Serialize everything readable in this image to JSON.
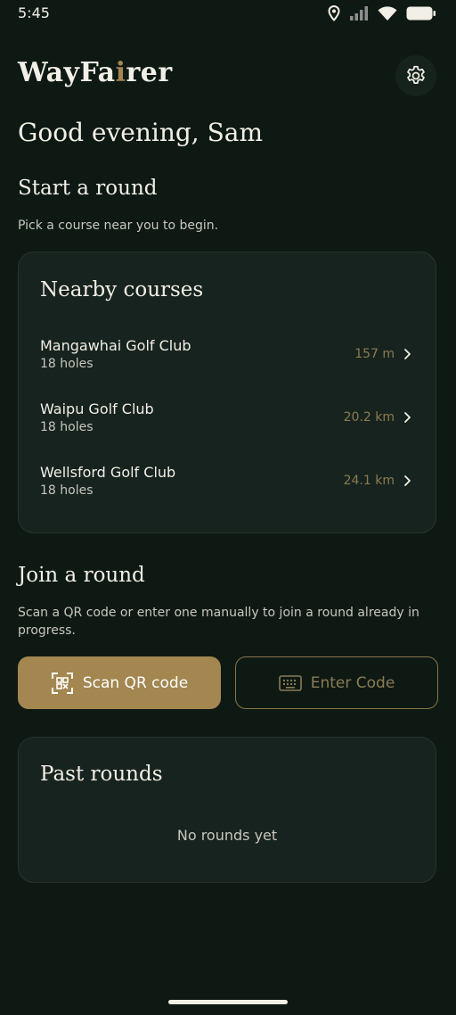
{
  "status_bar": {
    "time": "5:45",
    "icons": [
      "location-icon",
      "signal-icon",
      "wifi-icon",
      "battery-icon"
    ]
  },
  "header": {
    "logo_part1": "WayFa",
    "logo_part2": "i",
    "logo_part3": "rer",
    "settings_icon": "gear-icon"
  },
  "greeting": "Good evening, Sam",
  "start_round": {
    "title": "Start a round",
    "description": "Pick a course near you to begin."
  },
  "nearby": {
    "title": "Nearby courses",
    "courses": [
      {
        "name": "Mangawhai Golf Club",
        "holes": "18 holes",
        "distance": "157 m"
      },
      {
        "name": "Waipu Golf Club",
        "holes": "18 holes",
        "distance": "20.2 km"
      },
      {
        "name": "Wellsford Golf Club",
        "holes": "18 holes",
        "distance": "24.1 km"
      }
    ]
  },
  "join_round": {
    "title": "Join a round",
    "description": "Scan a QR code or enter one manually to join a round already in progress.",
    "scan_label": "Scan QR code",
    "code_label": "Enter Code"
  },
  "past_rounds": {
    "title": "Past rounds",
    "empty": "No rounds yet"
  },
  "colors": {
    "background": "#0e1914",
    "card": "#17231e",
    "accent_gold": "#a38650",
    "text": "#f2efe6"
  }
}
